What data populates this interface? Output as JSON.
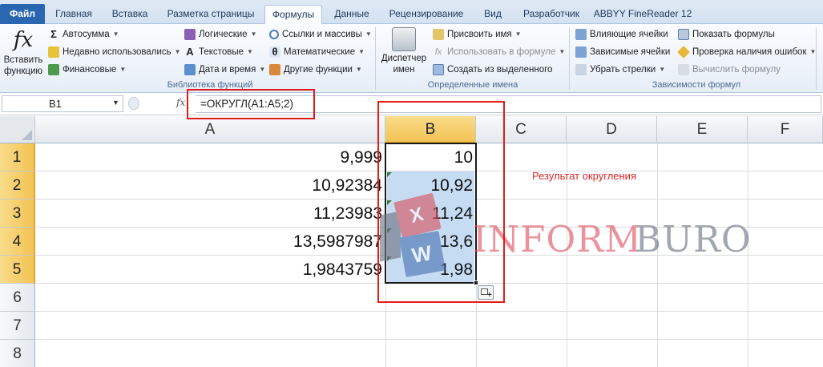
{
  "tabs": {
    "file": "Файл",
    "items": [
      "Главная",
      "Вставка",
      "Разметка страницы",
      "Формулы",
      "Данные",
      "Рецензирование",
      "Вид",
      "Разработчик",
      "ABBYY FineReader 12"
    ],
    "active": "Формулы"
  },
  "ribbon": {
    "insert_function": {
      "glyph": "fx",
      "line1": "Вставить",
      "line2": "функцию"
    },
    "library": {
      "label": "Библиотека функций",
      "col1": [
        "Автосумма",
        "Недавно использовались",
        "Финансовые"
      ],
      "col2": [
        "Логические",
        "Текстовые",
        "Дата и время"
      ],
      "col3": [
        "Ссылки и массивы",
        "Математические",
        "Другие функции"
      ]
    },
    "names": {
      "label": "Определенные имена",
      "manager_line1": "Диспетчер",
      "manager_line2": "имен",
      "items": [
        "Присвоить имя",
        "Использовать в формуле",
        "Создать из выделенного"
      ]
    },
    "audit": {
      "label": "Зависимости формул",
      "col1": [
        "Влияющие ячейки",
        "Зависимые ячейки",
        "Убрать стрелки"
      ],
      "col2": [
        "Показать формулы",
        "Проверка наличия ошибок",
        "Вычислить формулу"
      ]
    },
    "colors": {
      "accent": "#2a67b0",
      "file_tab": "#2a67b0"
    }
  },
  "formula_bar": {
    "name_box": "B1",
    "fx": "fx",
    "formula": "=ОКРУГЛ(A1:A5;2)"
  },
  "sheet": {
    "columns": [
      "A",
      "B",
      "C",
      "D",
      "E",
      "F"
    ],
    "rows": [
      "1",
      "2",
      "3",
      "4",
      "5",
      "6",
      "7",
      "8"
    ],
    "col_a": [
      "9,999",
      "10,92384",
      "11,23983",
      "13,5987987",
      "1,9843759"
    ],
    "col_b": [
      "10",
      "10,92",
      "11,24",
      "13,6",
      "1,98"
    ],
    "note": "Результат округления",
    "selection_color": "#c6dcf3"
  },
  "annotation_color": "#e21b1b",
  "watermark": {
    "part1": "INFORM",
    "part2": "BURO",
    "color1": "#e05060",
    "color2": "#6a7080"
  }
}
